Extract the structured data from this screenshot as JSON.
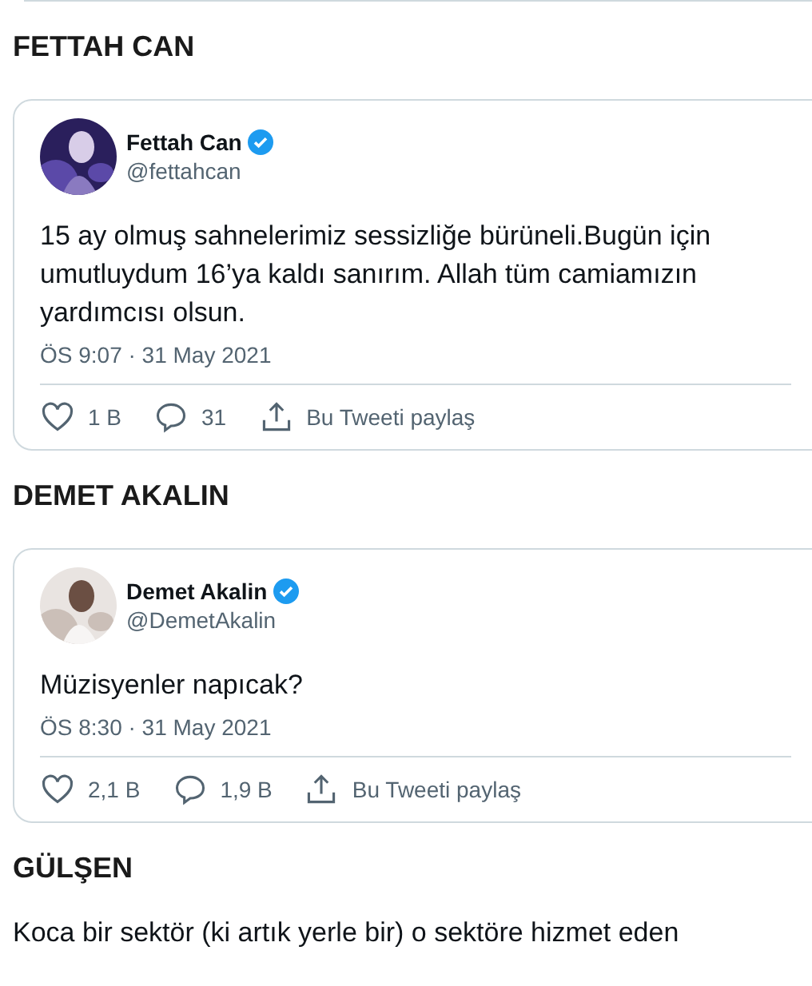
{
  "sections": [
    {
      "heading": "FETTAH CAN",
      "tweet": {
        "name": "Fettah Can",
        "verified": true,
        "handle": "@fettahcan",
        "lines": [
          "15 ay olmuş sahnelerimiz sessizliğe bürüneli.Bugün için",
          "umutluydum 16’ya  kaldı sanırım. Allah tüm camiamızın",
          "yardımcısı olsun."
        ],
        "time": "ÖS 9:07 · 31 May 2021",
        "likes": "1 B",
        "replies": "31",
        "share": "Bu Tweeti paylaş"
      }
    },
    {
      "heading": "DEMET AKALIN",
      "tweet": {
        "name": "Demet Akalin",
        "verified": true,
        "handle": "@DemetAkalin",
        "lines": [
          "Müzisyenler napıcak?"
        ],
        "time": "ÖS 8:30 · 31 May 2021",
        "likes": "2,1 B",
        "replies": "1,9 B",
        "share": "Bu Tweeti paylaş"
      }
    },
    {
      "heading": "GÜLŞEN",
      "paragraph": "Koca bir sektör (ki artık yerle bir) o sektöre hizmet eden"
    }
  ]
}
